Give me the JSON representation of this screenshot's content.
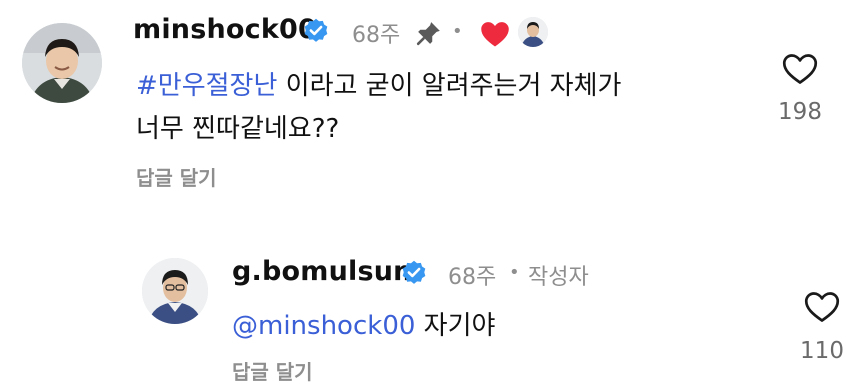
{
  "comment": {
    "username": "minshock00",
    "time": "68주",
    "separator": "•",
    "text_hashtag": "#만우절장난",
    "text_line1_rest": " 이라고 굳이 알려주는거 자체가",
    "text_line2": "너무 찐따같네요??",
    "reply_label": "답글 달기",
    "like_count": "198",
    "icons": [
      "verified-badge-icon",
      "pin-icon",
      "heart-filled-icon",
      "creator-avatar-icon",
      "heart-outline-icon"
    ],
    "colors": {
      "verified": "#3897f0",
      "heart": "#ed2a3e",
      "link": "#3a5fd6"
    }
  },
  "reply": {
    "username": "g.bomulsum",
    "time": "68주",
    "separator": "•",
    "author_label": "작성자",
    "mention": "@minshock00",
    "text": " 자기야",
    "reply_label": "답글 달기",
    "like_count": "110"
  }
}
